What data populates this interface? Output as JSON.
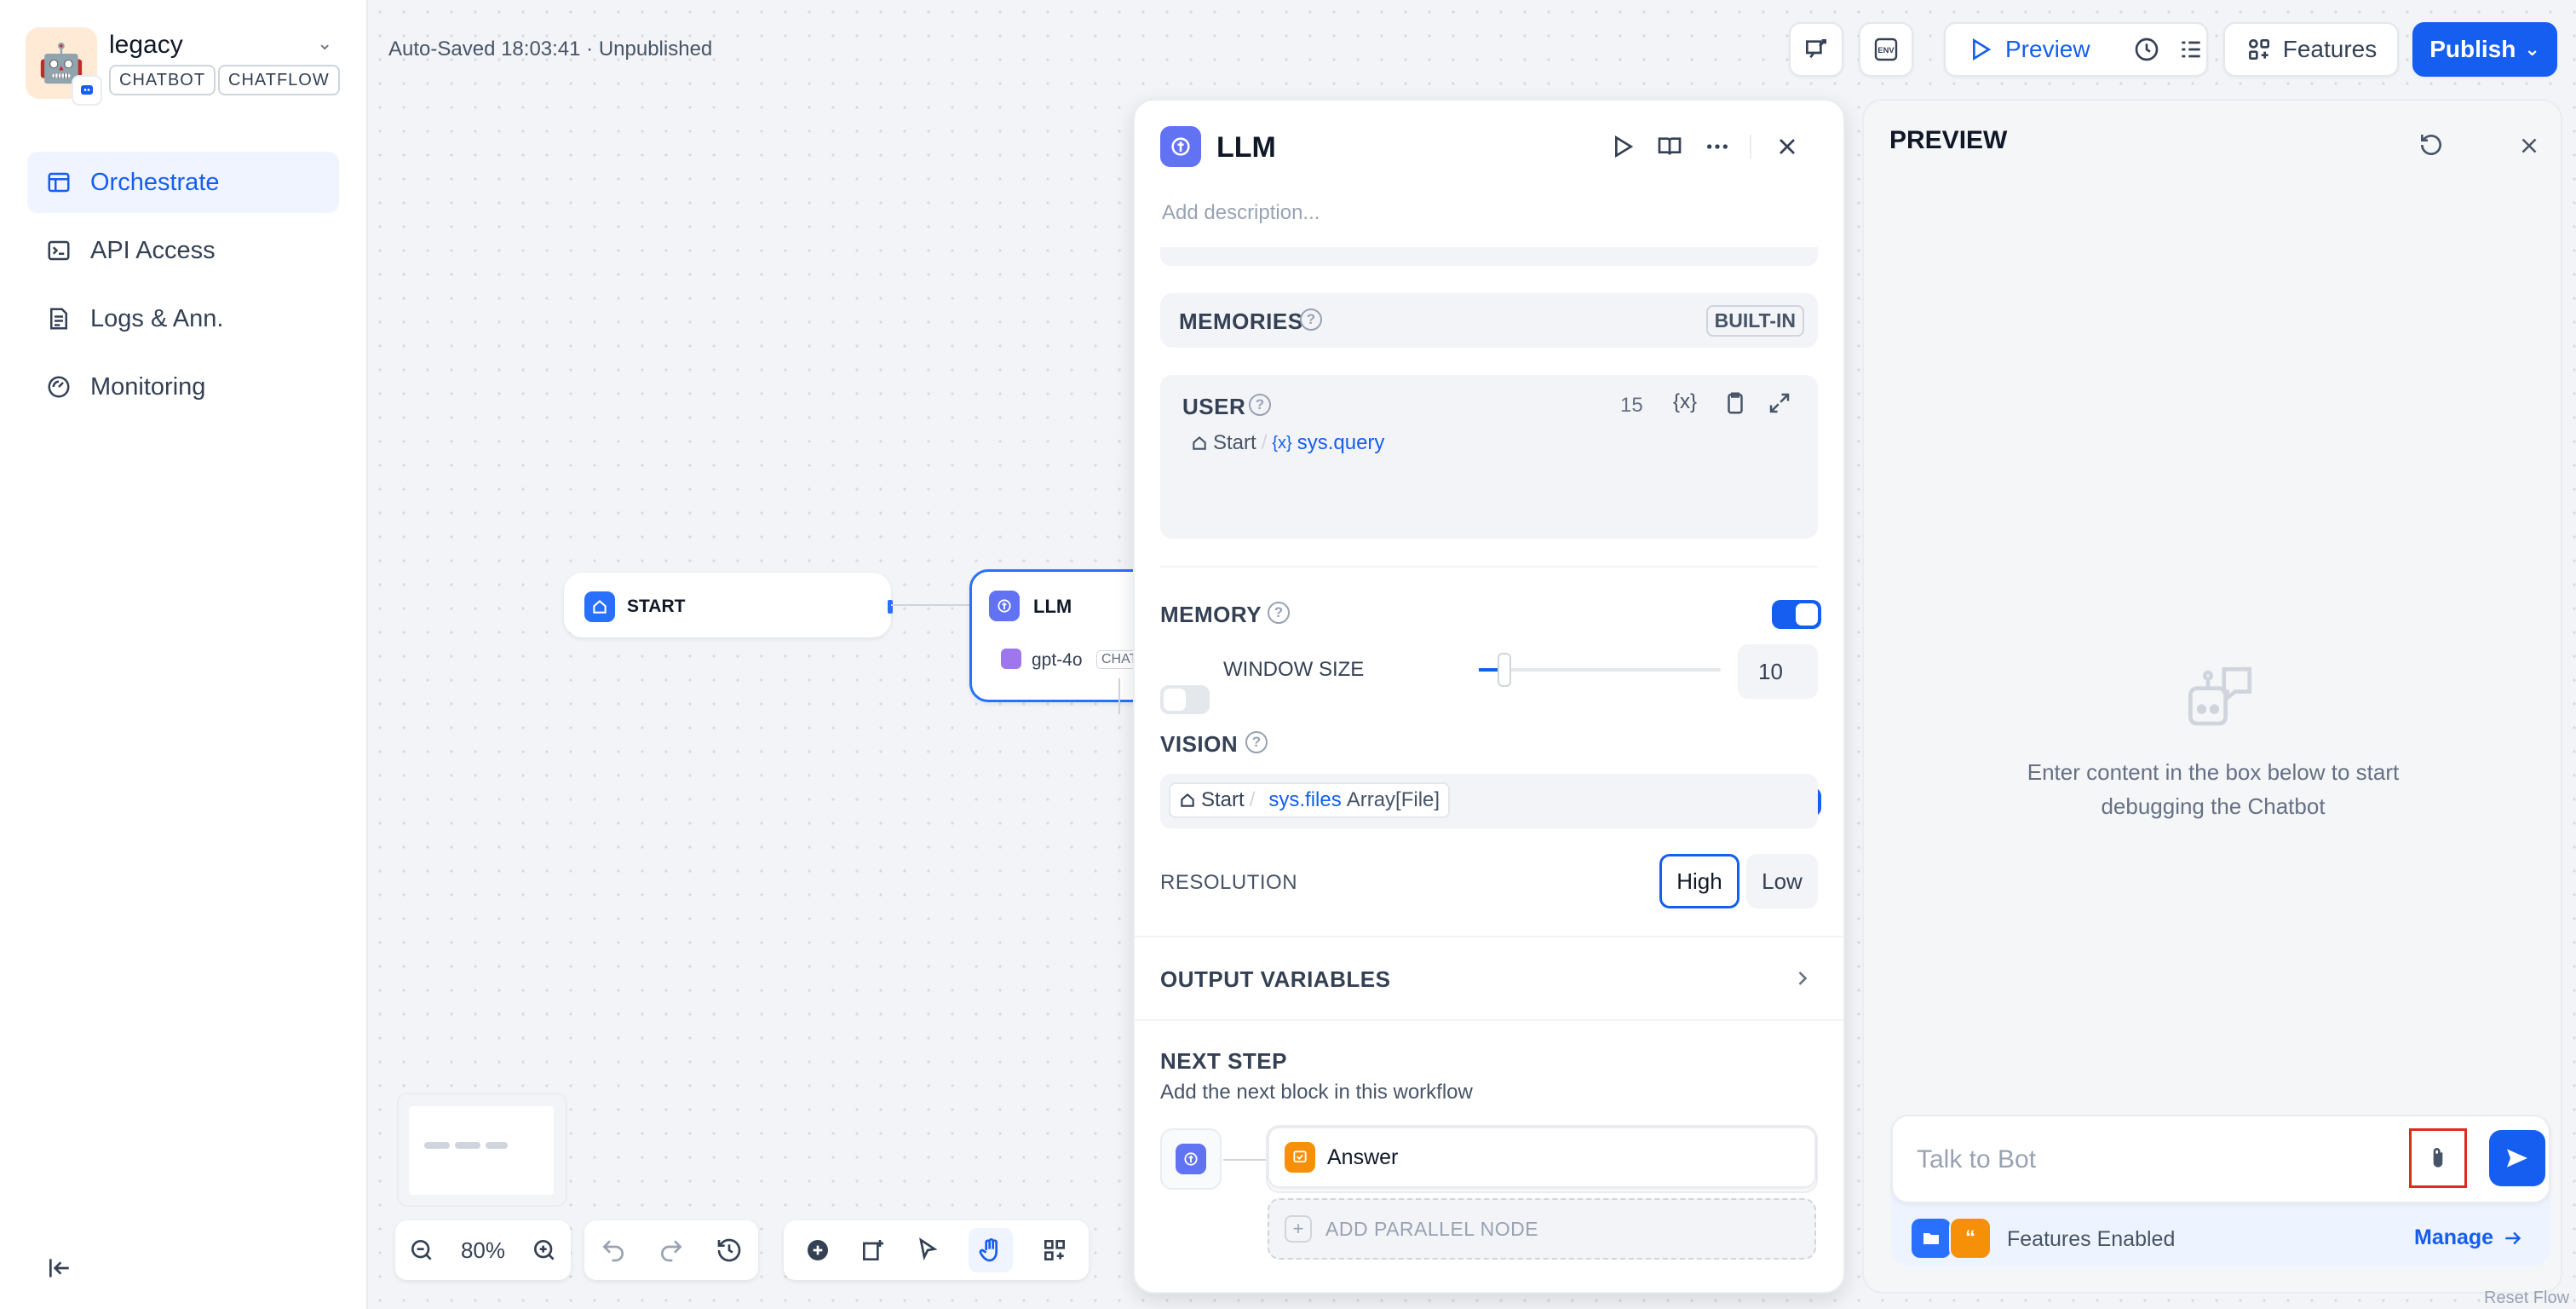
{
  "app": {
    "name": "legacy",
    "avatar": "🤖",
    "tags": [
      "CHATBOT",
      "CHATFLOW"
    ]
  },
  "sidebar": {
    "items": [
      {
        "label": "Orchestrate",
        "icon": "orchestrate-icon",
        "active": true
      },
      {
        "label": "API Access",
        "icon": "terminal-icon",
        "active": false
      },
      {
        "label": "Logs & Ann.",
        "icon": "logs-icon",
        "active": false
      },
      {
        "label": "Monitoring",
        "icon": "monitoring-icon",
        "active": false
      }
    ]
  },
  "header": {
    "autosave": "Auto-Saved 18:03:41 · Unpublished",
    "preview_label": "Preview",
    "features_label": "Features",
    "publish_label": "Publish"
  },
  "canvas": {
    "start_node": {
      "label": "START"
    },
    "llm_node": {
      "label": "LLM",
      "model": "gpt-4o",
      "model_tag": "CHAT"
    },
    "zoom": "80%"
  },
  "llm_panel": {
    "title": "LLM",
    "description_placeholder": "Add description...",
    "memories": {
      "label": "MEMORIES",
      "badge": "BUILT-IN"
    },
    "user": {
      "label": "USER",
      "count": "15",
      "var_source": "Start",
      "var_name": "sys.query"
    },
    "memory": {
      "label": "MEMORY",
      "enabled": true,
      "window_label": "WINDOW SIZE",
      "window_value": "10",
      "window_enabled": false
    },
    "vision": {
      "label": "VISION",
      "enabled": true,
      "var_source": "Start",
      "var_name": "sys.files",
      "var_type": "Array[File]"
    },
    "resolution": {
      "label": "RESOLUTION",
      "options": [
        "High",
        "Low"
      ],
      "selected": "High"
    },
    "output_variables": {
      "label": "OUTPUT VARIABLES"
    },
    "next_step": {
      "label": "NEXT STEP",
      "desc": "Add the next block in this workflow",
      "next_node": "Answer",
      "add_parallel": "ADD PARALLEL NODE"
    }
  },
  "preview": {
    "title": "PREVIEW",
    "empty_text": "Enter content in the box below to start debugging the Chatbot",
    "input_placeholder": "Talk to Bot",
    "features_enabled": "Features Enabled",
    "manage_label": "Manage",
    "reset_label": "Reset Flow"
  },
  "colors": {
    "accent": "#155eef",
    "llm_icon": "#6172f3",
    "answer_icon": "#f79009",
    "highlight_box": "#d92d20"
  }
}
